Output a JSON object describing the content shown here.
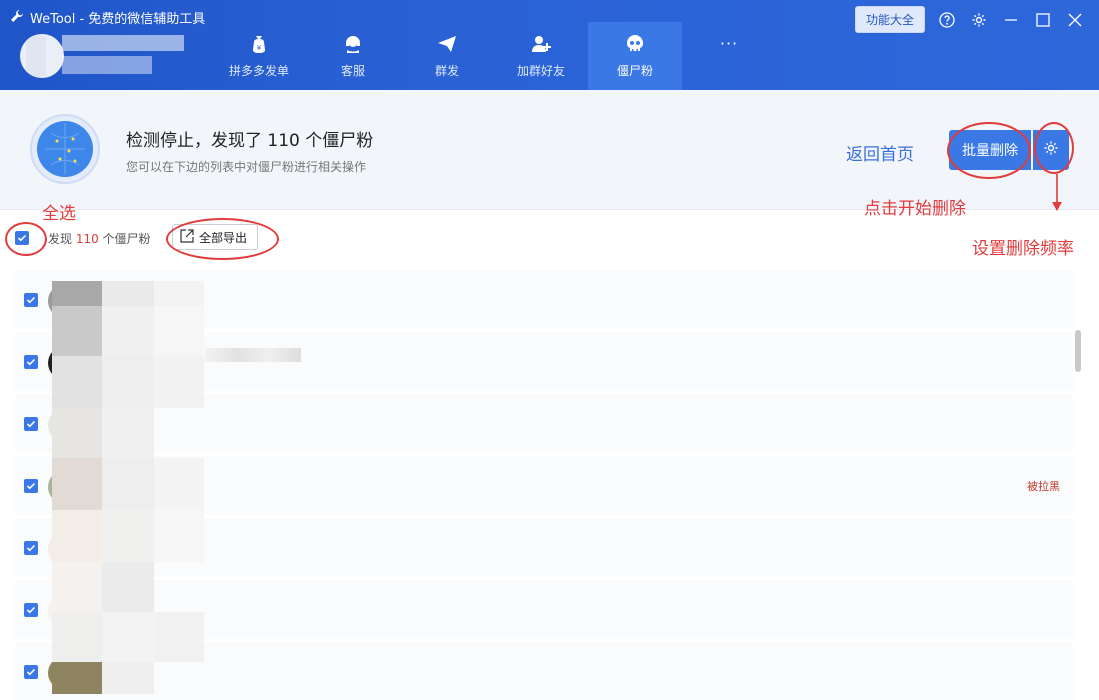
{
  "app": {
    "title": "WeTool - 免费的微信辅助工具",
    "func_button": "功能大全"
  },
  "nav": {
    "items": [
      {
        "label": "拼多多发单",
        "icon": "money-bag-icon"
      },
      {
        "label": "客服",
        "icon": "headset-icon"
      },
      {
        "label": "群发",
        "icon": "paper-plane-icon"
      },
      {
        "label": "加群好友",
        "icon": "add-user-icon"
      },
      {
        "label": "僵尸粉",
        "icon": "skull-icon",
        "active": true
      }
    ],
    "more": "···"
  },
  "info": {
    "title": "检测停止，发现了 110 个僵尸粉",
    "subtitle": "您可以在下边的列表中对僵尸粉进行相关操作",
    "back_home": "返回首页",
    "batch_delete": "批量删除"
  },
  "toolbar": {
    "found_prefix": "发现 ",
    "found_count": "110",
    "found_suffix": " 个僵尸粉",
    "export_label": "全部导出"
  },
  "rows": [
    {
      "status": ""
    },
    {
      "status": ""
    },
    {
      "status": ""
    },
    {
      "status": "被拉黑"
    },
    {
      "status": ""
    },
    {
      "status": ""
    },
    {
      "status": ""
    }
  ],
  "annotations": {
    "select_all": "全选",
    "click_delete": "点击开始删除",
    "set_frequency": "设置删除频率"
  },
  "colors": {
    "header": "#2a62d6",
    "accent": "#3a78e6",
    "annotation": "#e23b3b"
  }
}
